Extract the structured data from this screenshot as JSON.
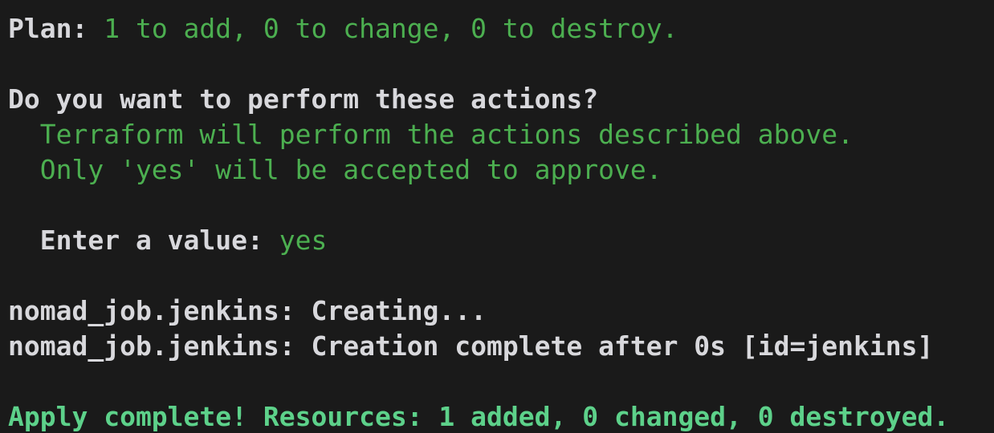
{
  "terminal": {
    "background_color": "#1a1a1a",
    "white_color": "#d8d8dc",
    "green_color": "#4caf50",
    "bright_green_color": "#5dd18a",
    "lines": [
      {
        "id": "plan-summary",
        "segments": [
          {
            "text": "Plan: ",
            "style": "white"
          },
          {
            "text": "1 to add, 0 to change, 0 to destroy.",
            "style": "green"
          }
        ]
      },
      {
        "id": "blank-1",
        "segments": []
      },
      {
        "id": "confirm-prompt",
        "segments": [
          {
            "text": "Do you want to perform these actions?",
            "style": "white"
          }
        ]
      },
      {
        "id": "confirm-desc-1",
        "segments": [
          {
            "text": "  Terraform will perform the actions described above.",
            "style": "green"
          }
        ]
      },
      {
        "id": "confirm-desc-2",
        "segments": [
          {
            "text": "  Only 'yes' will be accepted to approve.",
            "style": "green"
          }
        ]
      },
      {
        "id": "blank-2",
        "segments": []
      },
      {
        "id": "enter-value",
        "segments": [
          {
            "text": "  Enter a value: ",
            "style": "white"
          },
          {
            "text": "yes",
            "style": "green"
          }
        ]
      },
      {
        "id": "blank-3",
        "segments": []
      },
      {
        "id": "resource-creating",
        "segments": [
          {
            "text": "nomad_job.jenkins: Creating...",
            "style": "white"
          }
        ]
      },
      {
        "id": "resource-created",
        "segments": [
          {
            "text": "nomad_job.jenkins: Creation complete after 0s [id=jenkins]",
            "style": "white"
          }
        ]
      },
      {
        "id": "blank-4",
        "segments": []
      },
      {
        "id": "apply-complete",
        "segments": [
          {
            "text": "Apply complete! Resources: 1 added, 0 changed, 0 destroyed.",
            "style": "green-bold"
          }
        ]
      }
    ]
  }
}
